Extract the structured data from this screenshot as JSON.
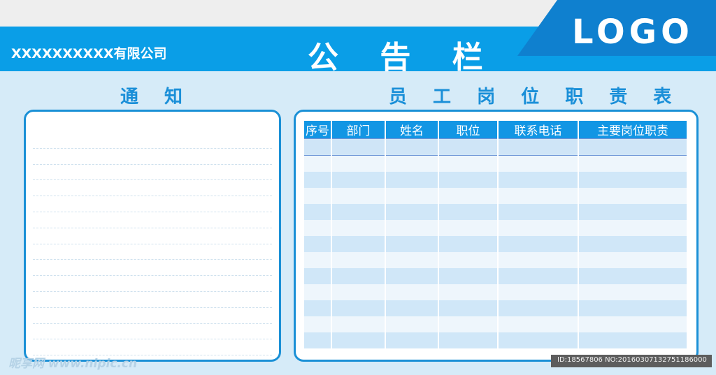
{
  "header": {
    "company": "XXXXXXXXXX有限公司",
    "title": "公 告 栏",
    "logo": "LOGO"
  },
  "colors": {
    "primary": "#0a9ee7",
    "dark_blue": "#1a90d6",
    "background": "#d6ebf8"
  },
  "notice": {
    "title": "通 知",
    "line_count": 14
  },
  "duty_table": {
    "title": "员 工 岗 位 职 责 表",
    "columns": [
      "序号",
      "部门",
      "姓名",
      "职位",
      "联系电话",
      "主要岗位职责"
    ],
    "row_count": 13
  },
  "watermark": {
    "text": "昵享网 www.nipic.cn",
    "id_text": "ID:18567806 NO:20160307132751186000"
  }
}
